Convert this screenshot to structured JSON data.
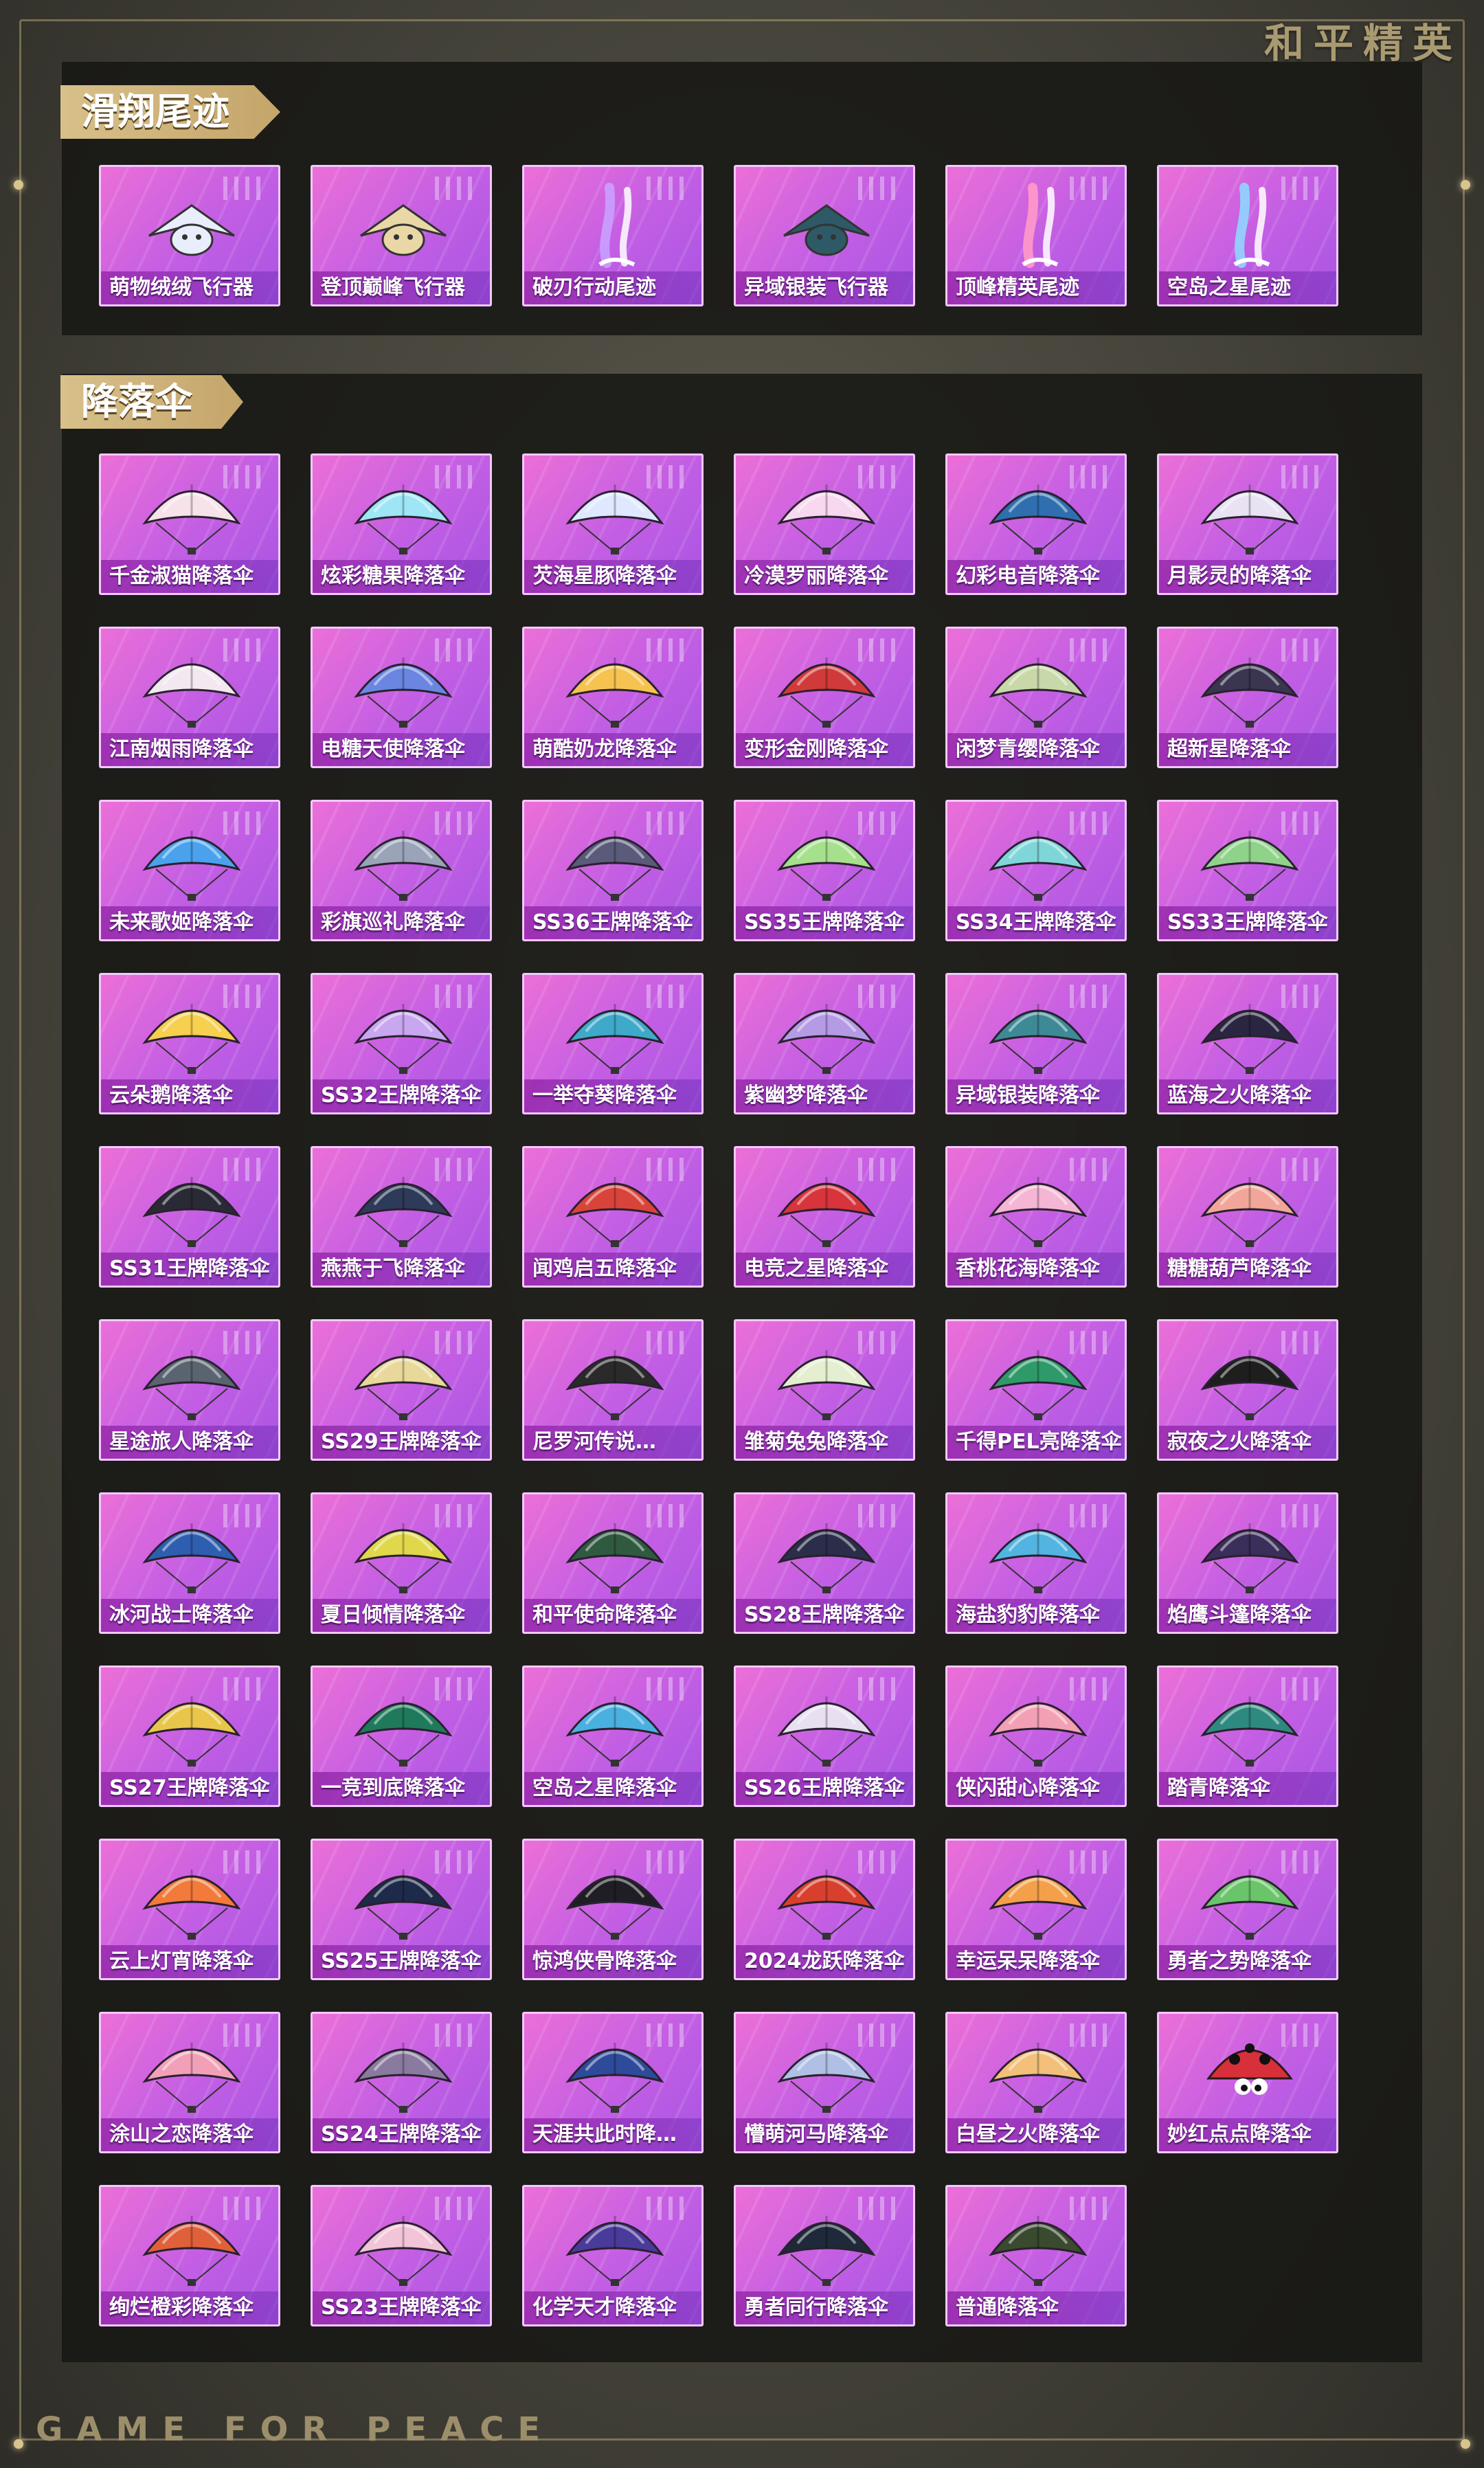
{
  "brand": "和平精英",
  "footer": "GAME FOR PEACE",
  "colors": {
    "card_pink": "#ec6fd7",
    "card_purple": "#a855e2",
    "title_gold": "#c4a56a",
    "panel": "#161614"
  },
  "sections": [
    {
      "title": "滑翔尾迹",
      "items": [
        {
          "label": "萌物绒绒飞行器",
          "icon": "plush-glider-icon",
          "color": "#e8eefc"
        },
        {
          "label": "登顶巅峰飞行器",
          "icon": "gold-glider-icon",
          "color": "#e9d8a6"
        },
        {
          "label": "破刃行动尾迹",
          "icon": "trail-icon",
          "color": "#c9a0ff"
        },
        {
          "label": "异域银装飞行器",
          "icon": "dark-glider-icon",
          "color": "#2d5a66"
        },
        {
          "label": "顶峰精英尾迹",
          "icon": "trail-icon",
          "color": "#ff9ac8"
        },
        {
          "label": "空岛之星尾迹",
          "icon": "trail-icon",
          "color": "#8fd6ff"
        }
      ]
    },
    {
      "title": "降落伞",
      "items": [
        {
          "label": "千金淑猫降落伞",
          "icon": "cat-parachute-icon",
          "color": "#f7e2ea"
        },
        {
          "label": "炫彩糖果降落伞",
          "icon": "parachute-icon",
          "color": "#9ee6f5"
        },
        {
          "label": "芡海星豚降落伞",
          "icon": "parachute-icon",
          "color": "#dfe8ff"
        },
        {
          "label": "冷漠罗丽降落伞",
          "icon": "parachute-icon",
          "color": "#f7d8ef"
        },
        {
          "label": "幻彩电音降落伞",
          "icon": "parachute-icon",
          "color": "#2f6fb0"
        },
        {
          "label": "月影灵的降落伞",
          "icon": "parachute-icon",
          "color": "#e8e2f2"
        },
        {
          "label": "江南烟雨降落伞",
          "icon": "parachute-icon",
          "color": "#f3e7f0"
        },
        {
          "label": "电糖天使降落伞",
          "icon": "parachute-icon",
          "color": "#6a86e0"
        },
        {
          "label": "萌酷奶龙降落伞",
          "icon": "parachute-icon",
          "color": "#f6c351"
        },
        {
          "label": "变形金刚降落伞",
          "icon": "parachute-icon",
          "color": "#d13a3a"
        },
        {
          "label": "闲梦青缨降落伞",
          "icon": "parachute-icon",
          "color": "#c8d8a8"
        },
        {
          "label": "超新星降落伞",
          "icon": "parachute-icon",
          "color": "#3a3550"
        },
        {
          "label": "未来歌姬降落伞",
          "icon": "parachute-icon",
          "color": "#4aa2ec"
        },
        {
          "label": "彩旗巡礼降落伞",
          "icon": "parachute-icon",
          "color": "#9aa4b8"
        },
        {
          "label": "SS36王牌降落伞",
          "icon": "parachute-icon",
          "color": "#5a5a7a"
        },
        {
          "label": "SS35王牌降落伞",
          "icon": "parachute-icon",
          "color": "#a6e08c"
        },
        {
          "label": "SS34王牌降落伞",
          "icon": "parachute-icon",
          "color": "#7fd6d8"
        },
        {
          "label": "SS33王牌降落伞",
          "icon": "parachute-icon",
          "color": "#8fd28a"
        },
        {
          "label": "云朵鹅降落伞",
          "icon": "parachute-icon",
          "color": "#f6d04e"
        },
        {
          "label": "SS32王牌降落伞",
          "icon": "parachute-icon",
          "color": "#c9a6f0"
        },
        {
          "label": "一举夺葵降落伞",
          "icon": "parachute-icon",
          "color": "#3fa9c9"
        },
        {
          "label": "紫幽梦降落伞",
          "icon": "parachute-icon",
          "color": "#b59ae6"
        },
        {
          "label": "异域银装降落伞",
          "icon": "parachute-icon",
          "color": "#3d8a96"
        },
        {
          "label": "蓝海之火降落伞",
          "icon": "parachute-icon",
          "color": "#2a2540"
        },
        {
          "label": "SS31王牌降落伞",
          "icon": "parachute-icon",
          "color": "#2a2a36"
        },
        {
          "label": "燕燕于飞降落伞",
          "icon": "parachute-icon",
          "color": "#2e3a5a"
        },
        {
          "label": "闻鸡启五降落伞",
          "icon": "parachute-icon",
          "color": "#d9443a"
        },
        {
          "label": "电竞之星降落伞",
          "icon": "parachute-icon",
          "color": "#d8343c"
        },
        {
          "label": "香桃花海降落伞",
          "icon": "parachute-icon",
          "color": "#f4b6d4"
        },
        {
          "label": "糖糖葫芦降落伞",
          "icon": "parachute-icon",
          "color": "#f2a69a"
        },
        {
          "label": "星途旅人降落伞",
          "icon": "parachute-icon",
          "color": "#5a6470"
        },
        {
          "label": "SS29王牌降落伞",
          "icon": "parachute-icon",
          "color": "#e8d89a"
        },
        {
          "label": "尼罗河传说…",
          "icon": "parachute-icon",
          "color": "#2a2a2a"
        },
        {
          "label": "雏菊兔兔降落伞",
          "icon": "parachute-icon",
          "color": "#e4eed0"
        },
        {
          "label": "千得PEL亮降落伞",
          "icon": "parachute-icon",
          "color": "#2e9a6a"
        },
        {
          "label": "寂夜之火降落伞",
          "icon": "parachute-icon",
          "color": "#1e1e1e"
        },
        {
          "label": "冰河战士降落伞",
          "icon": "parachute-icon",
          "color": "#2e5eb0"
        },
        {
          "label": "夏日倾情降落伞",
          "icon": "parachute-icon",
          "color": "#e0d84a"
        },
        {
          "label": "和平使命降落伞",
          "icon": "parachute-icon",
          "color": "#2f5a40"
        },
        {
          "label": "SS28王牌降落伞",
          "icon": "parachute-icon",
          "color": "#2a2e4a"
        },
        {
          "label": "海盐豹豹降落伞",
          "icon": "parachute-icon",
          "color": "#52b4e0"
        },
        {
          "label": "焰鹰斗篷降落伞",
          "icon": "parachute-icon",
          "color": "#3a2e5a"
        },
        {
          "label": "SS27王牌降落伞",
          "icon": "parachute-icon",
          "color": "#e8c64a"
        },
        {
          "label": "一竞到底降落伞",
          "icon": "parachute-icon",
          "color": "#1e7a5a"
        },
        {
          "label": "空岛之星降落伞",
          "icon": "parachute-icon",
          "color": "#4ab0e0"
        },
        {
          "label": "SS26王牌降落伞",
          "icon": "parachute-icon",
          "color": "#e8e0f0"
        },
        {
          "label": "侠闪甜心降落伞",
          "icon": "parachute-icon",
          "color": "#f2a0b4"
        },
        {
          "label": "踏青降落伞",
          "icon": "parachute-icon",
          "color": "#2e8a80"
        },
        {
          "label": "云上灯宵降落伞",
          "icon": "parachute-icon",
          "color": "#f27a3a"
        },
        {
          "label": "SS25王牌降落伞",
          "icon": "parachute-icon",
          "color": "#1e2a4a"
        },
        {
          "label": "惊鸿侠骨降落伞",
          "icon": "parachute-icon",
          "color": "#1e1e24"
        },
        {
          "label": "2024龙跃降落伞",
          "icon": "parachute-icon",
          "color": "#d8402e"
        },
        {
          "label": "幸运呆呆降落伞",
          "icon": "parachute-icon",
          "color": "#f4a04a"
        },
        {
          "label": "勇者之势降落伞",
          "icon": "parachute-icon",
          "color": "#6ac46a"
        },
        {
          "label": "涂山之恋降落伞",
          "icon": "parachute-icon",
          "color": "#f2a0b8"
        },
        {
          "label": "SS24王牌降落伞",
          "icon": "parachute-icon",
          "color": "#8a7aa0"
        },
        {
          "label": "天涯共此时降…",
          "icon": "parachute-icon",
          "color": "#2e4a9a"
        },
        {
          "label": "懵萌河马降落伞",
          "icon": "parachute-icon",
          "color": "#b0c0e4"
        },
        {
          "label": "白昼之火降落伞",
          "icon": "parachute-icon",
          "color": "#f2c07a"
        },
        {
          "label": "妙红点点降落伞",
          "icon": "ladybug-parachute-icon",
          "color": "#d8303a"
        },
        {
          "label": "绚烂橙彩降落伞",
          "icon": "parachute-icon",
          "color": "#e0603a"
        },
        {
          "label": "SS23王牌降落伞",
          "icon": "parachute-icon",
          "color": "#f2c4d8"
        },
        {
          "label": "化学天才降落伞",
          "icon": "parachute-icon",
          "color": "#4a3a9a"
        },
        {
          "label": "勇者同行降落伞",
          "icon": "parachute-icon",
          "color": "#1e2a3a"
        },
        {
          "label": "普通降落伞",
          "icon": "parachute-icon",
          "color": "#3a4a2e"
        }
      ]
    }
  ]
}
